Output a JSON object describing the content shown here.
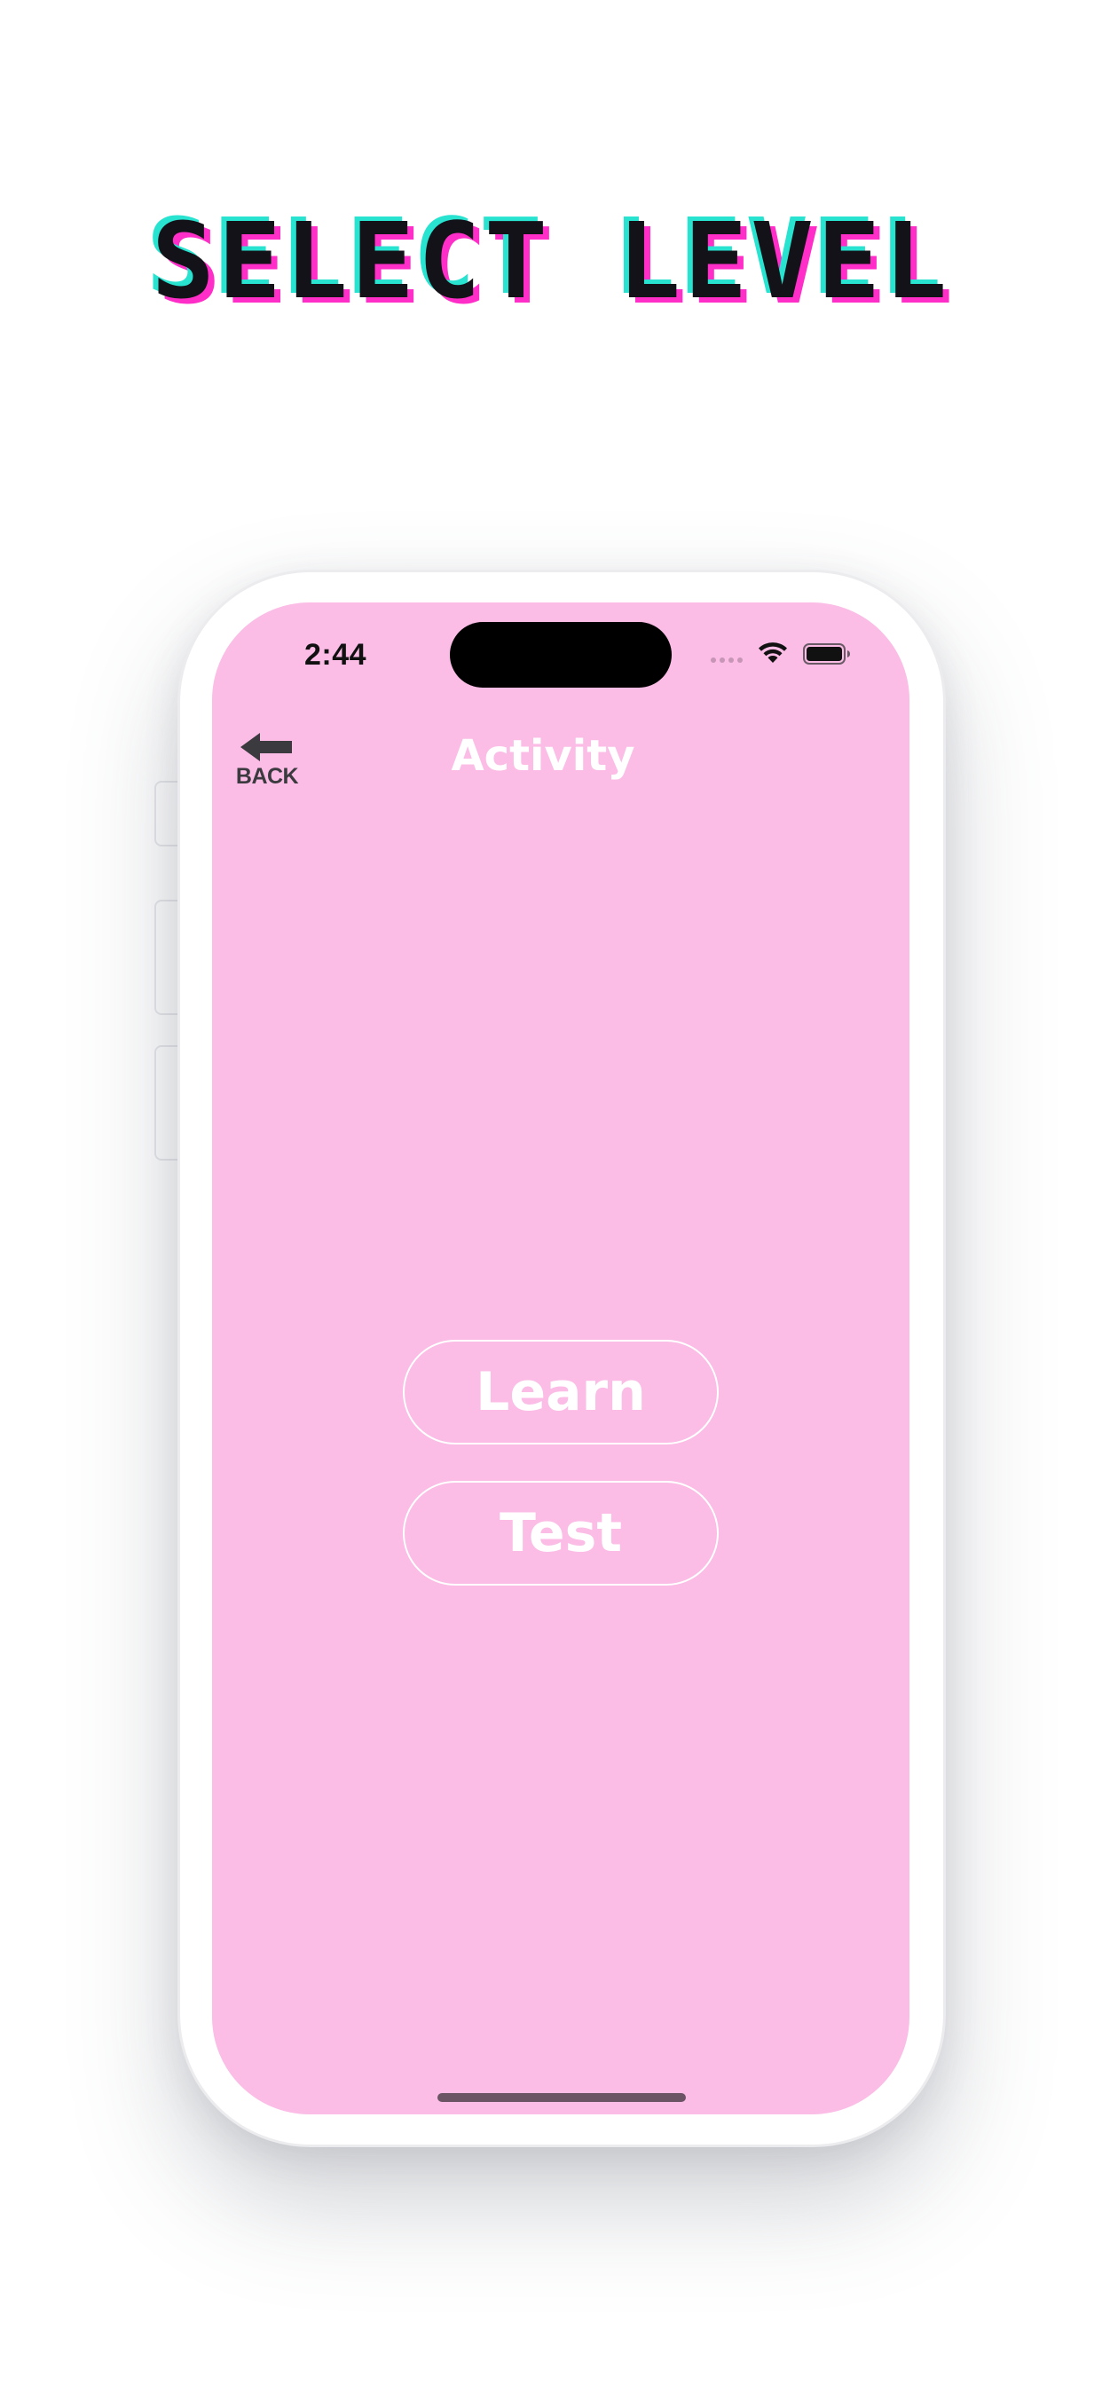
{
  "headline": {
    "text": "SELECT LEVEL",
    "colors": {
      "main": "#121218",
      "shadow_cyan": "#27e3d0",
      "shadow_magenta": "#ff2ec8"
    }
  },
  "status_bar": {
    "time": "2:44",
    "icons": [
      "cellular-signal-icon",
      "wifi-icon",
      "battery-icon"
    ]
  },
  "nav": {
    "back_label": "BACK",
    "back_icon": "arrow-left-icon",
    "title": "Activity"
  },
  "actions": {
    "learn_label": "Learn",
    "test_label": "Test"
  },
  "theme": {
    "screen_background": "#fbbce6",
    "button_border": "#ffffff",
    "text_color": "#ffffff"
  }
}
